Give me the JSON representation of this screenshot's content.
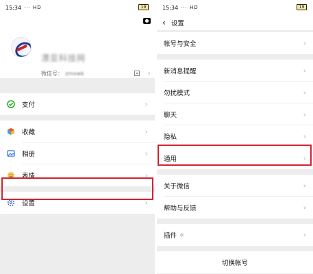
{
  "left": {
    "status": {
      "time": "15:34",
      "signal": "··· HD",
      "battery": "19"
    },
    "profile": {
      "nickname": "漂亚科技网",
      "wechat_id_label": "微信号：",
      "wechat_id_value": "zmxwk"
    },
    "menu": [
      {
        "label": "支付",
        "icon": "payment-icon"
      },
      {
        "label": "收藏",
        "icon": "favorites-icon"
      },
      {
        "label": "相册",
        "icon": "album-icon"
      },
      {
        "label": "表情",
        "icon": "stickers-icon"
      },
      {
        "label": "设置",
        "icon": "settings-icon"
      }
    ]
  },
  "right": {
    "status": {
      "time": "15:34",
      "signal": "··· HD",
      "battery": "19"
    },
    "title": "设置",
    "items": [
      {
        "label": "帐号与安全"
      },
      {
        "label": "新消息提醒"
      },
      {
        "label": "勿扰模式"
      },
      {
        "label": "聊天"
      },
      {
        "label": "隐私"
      },
      {
        "label": "通用"
      },
      {
        "label": "关于微信"
      },
      {
        "label": "帮助与反馈"
      },
      {
        "label": "插件"
      }
    ],
    "switch_account": "切换帐号"
  },
  "colors": {
    "highlight": "#d0222f",
    "payment": "#1aad19",
    "album": "#2f6fd6",
    "stickers": "#e9a53a",
    "settings": "#3b6fcf",
    "favorites": "#e55934"
  }
}
